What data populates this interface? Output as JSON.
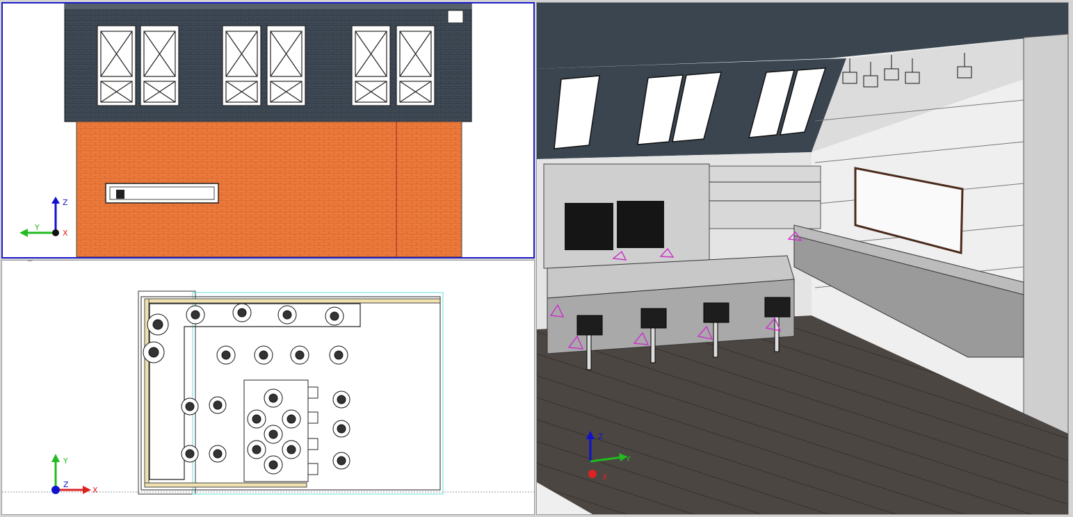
{
  "viewports": [
    {
      "id": "front",
      "label": "front-elevation-viewport",
      "active": true
    },
    {
      "id": "plan",
      "label": "plan-viewport",
      "active": false
    },
    {
      "id": "perspective",
      "label": "perspective-viewport",
      "active": false
    }
  ],
  "axes": {
    "front": {
      "up": "Z",
      "left": "Y",
      "depth": "X"
    },
    "plan": {
      "up": "Y",
      "right": "X",
      "depth": "Z"
    },
    "perspective": {
      "up": "Z",
      "right": "Y",
      "depth": "X"
    }
  },
  "colors": {
    "active_border": "#1a1acc",
    "roof": "#3d4853",
    "brick": "#e8773a",
    "floor": "#4a4440",
    "axis_x": "#dd2222",
    "axis_y": "#22bb22",
    "axis_z": "#1111cc",
    "light_marker": "#cc33cc"
  }
}
